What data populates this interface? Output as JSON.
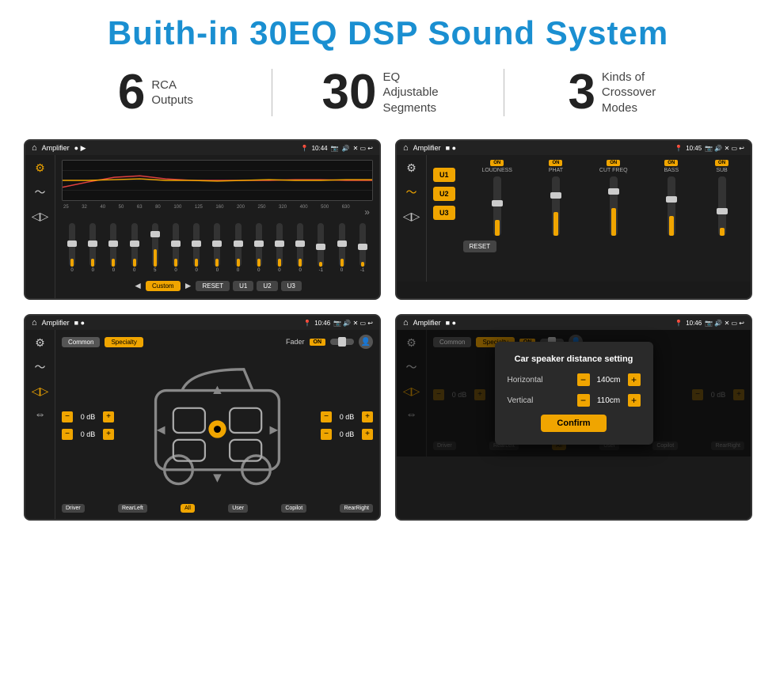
{
  "page": {
    "title": "Buith-in 30EQ DSP Sound System"
  },
  "stats": [
    {
      "number": "6",
      "text": "RCA\nOutputs"
    },
    {
      "number": "30",
      "text": "EQ Adjustable\nSegments"
    },
    {
      "number": "3",
      "text": "Kinds of\nCrossover Modes"
    }
  ],
  "screens": {
    "screen1": {
      "title": "Amplifier",
      "time": "10:44",
      "frequencies": [
        "25",
        "32",
        "40",
        "50",
        "63",
        "80",
        "100",
        "125",
        "160",
        "200",
        "250",
        "320",
        "400",
        "500",
        "630"
      ],
      "values": [
        "0",
        "0",
        "0",
        "0",
        "5",
        "0",
        "0",
        "0",
        "0",
        "0",
        "0",
        "0",
        "-1",
        "0",
        "-1"
      ],
      "preset": "Custom",
      "buttons": [
        "RESET",
        "U1",
        "U2",
        "U3"
      ]
    },
    "screen2": {
      "title": "Amplifier",
      "time": "10:45",
      "uButtons": [
        "U1",
        "U2",
        "U3"
      ],
      "resetBtn": "RESET",
      "controls": [
        "LOUDNESS",
        "PHAT",
        "CUT FREQ",
        "BASS",
        "SUB"
      ]
    },
    "screen3": {
      "title": "Amplifier",
      "time": "10:46",
      "modes": [
        "Common",
        "Specialty"
      ],
      "faderLabel": "Fader",
      "faderOn": "ON",
      "dbValues": [
        "0 dB",
        "0 dB",
        "0 dB",
        "0 dB"
      ],
      "positions": [
        "Driver",
        "RearLeft",
        "All",
        "Copilot",
        "RearRight",
        "User"
      ]
    },
    "screen4": {
      "title": "Amplifier",
      "time": "10:46",
      "modes": [
        "Common",
        "Specialty"
      ],
      "faderOn": "ON",
      "dialog": {
        "title": "Car speaker distance setting",
        "fields": [
          {
            "label": "Horizontal",
            "value": "140cm"
          },
          {
            "label": "Vertical",
            "value": "110cm"
          }
        ],
        "confirmBtn": "Confirm"
      },
      "dbValues": [
        "0 dB",
        "0 dB"
      ],
      "positions": [
        "Driver",
        "RearLeft",
        "All",
        "Copilot",
        "RearRight",
        "User"
      ]
    }
  }
}
